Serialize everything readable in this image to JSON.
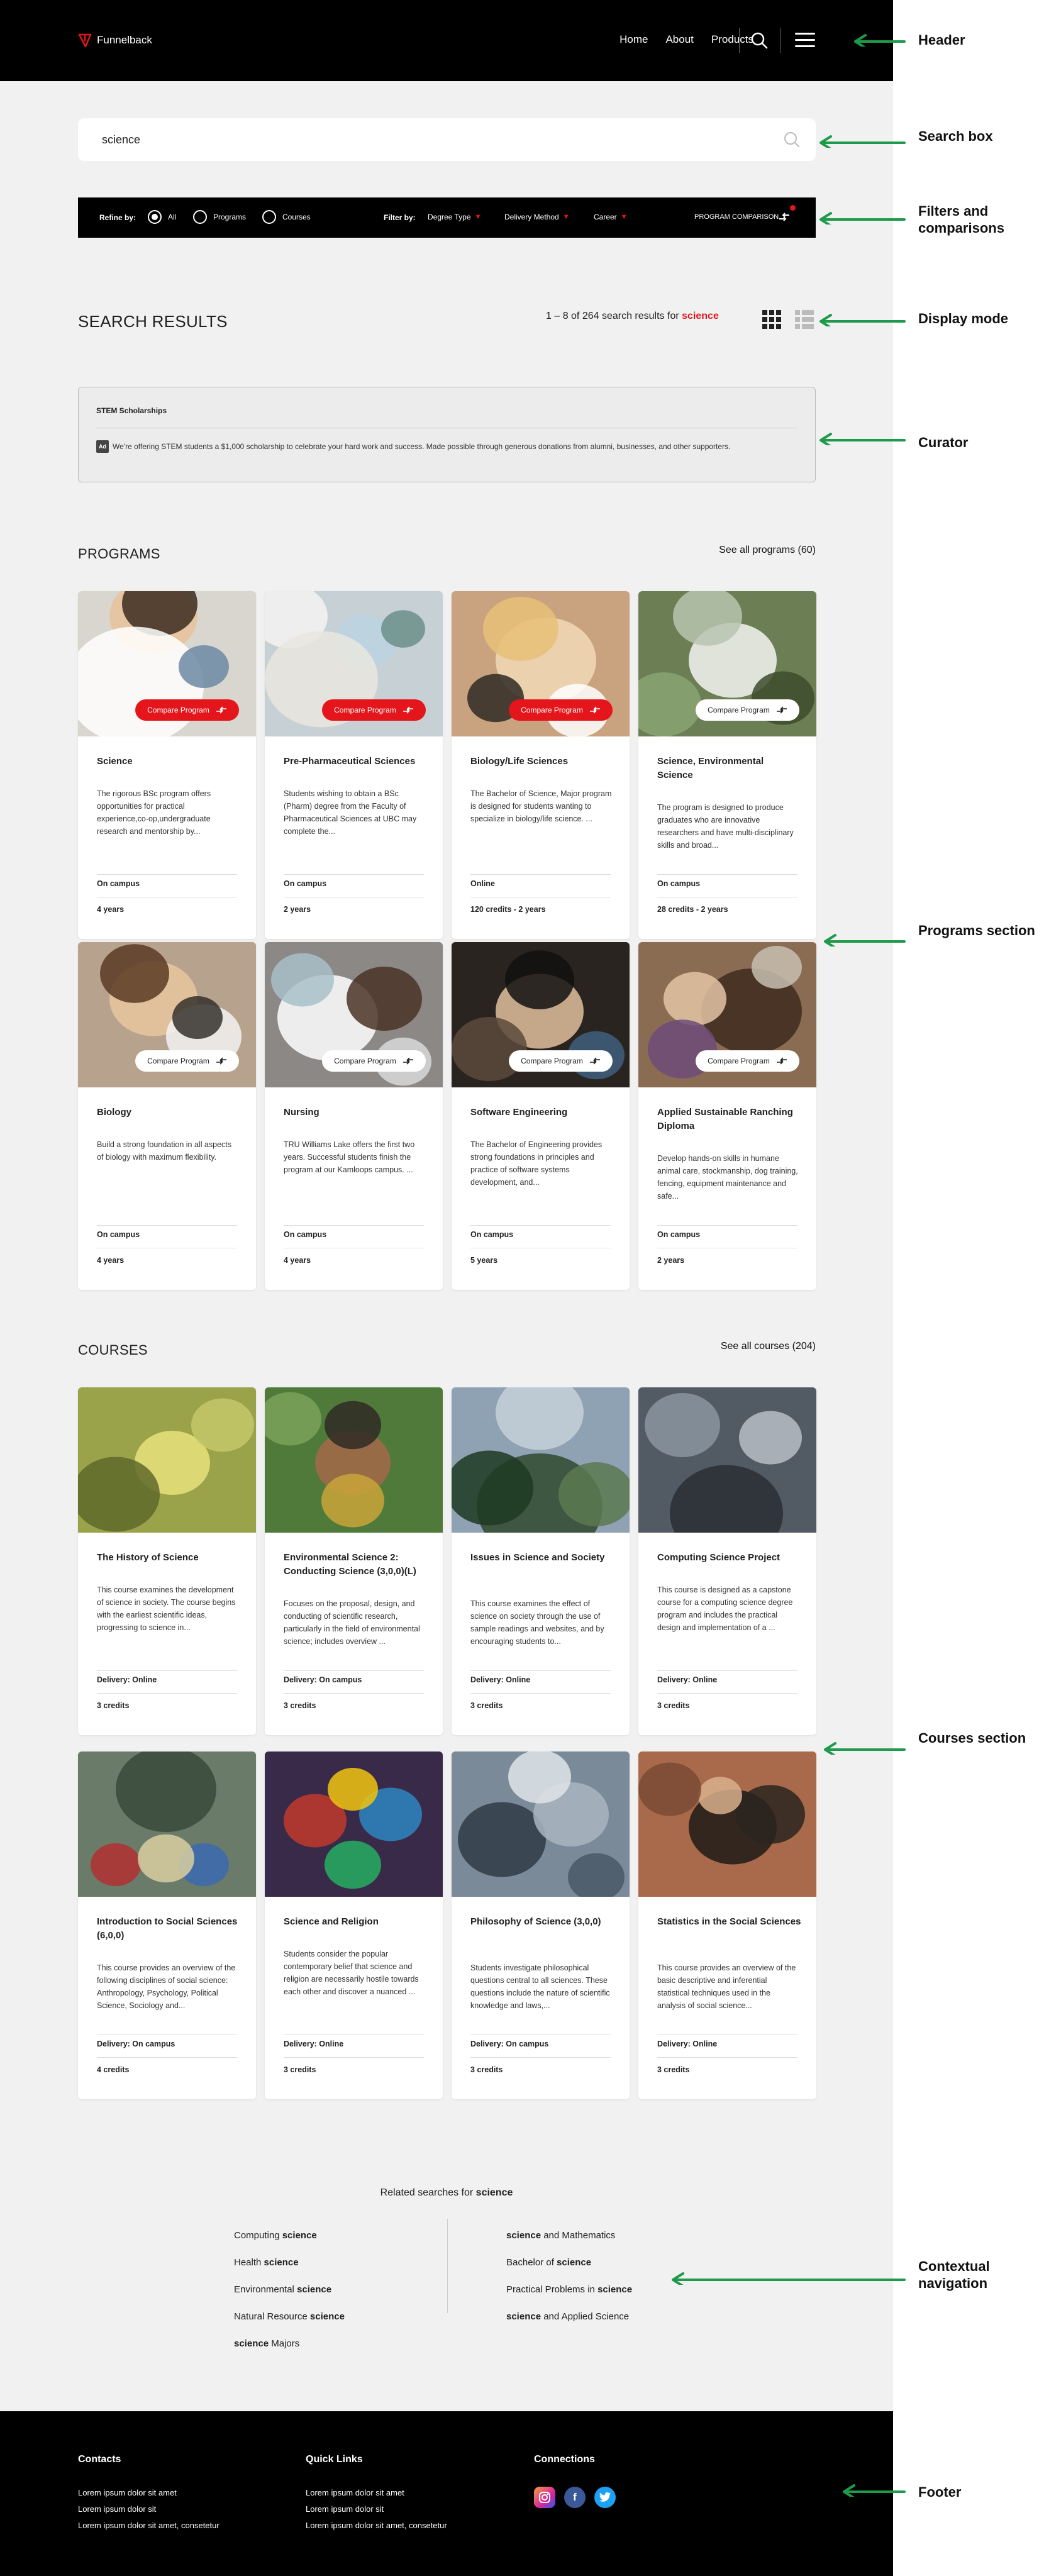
{
  "header": {
    "logo_text": "Funnelback",
    "nav": [
      "Home",
      "About",
      "Products"
    ]
  },
  "search": {
    "value": "science",
    "placeholder": ""
  },
  "filters": {
    "refine_label": "Refine by:",
    "options": [
      "All",
      "Programs",
      "Courses"
    ],
    "selected": "All",
    "filter_label": "Filter by:",
    "dropdowns": [
      "Degree Type",
      "Delivery Method",
      "Career"
    ],
    "compare_label": "PROGRAM COMPARISON"
  },
  "results": {
    "title": "SEARCH RESULTS",
    "count_prefix": "1 – 8 of 264 search results for ",
    "query": "science"
  },
  "curator": {
    "title": "STEM Scholarships",
    "badge": "Ad",
    "text": "We're offering STEM students a $1,000 scholarship to celebrate your hard work and success. Made possible through generous donations from alumni, businesses, and other supporters."
  },
  "programs": {
    "title": "PROGRAMS",
    "see_all": "See all programs (60)",
    "compare_label": "Compare Program",
    "cards": [
      {
        "title": "Science",
        "desc": "The rigorous BSc program offers opportunities for practical experience,co-op,undergraduate research and mentorship by...",
        "meta1": "On campus",
        "meta2": "4 years",
        "selected": true
      },
      {
        "title": "Pre-Pharmaceutical Sciences",
        "desc": "Students wishing to obtain a BSc (Pharm) degree from the Faculty of Pharmaceutical Sciences at UBC may complete the...",
        "meta1": "On campus",
        "meta2": "2 years",
        "selected": true
      },
      {
        "title": "Biology/Life Sciences",
        "desc": "The Bachelor of Science, Major program is designed for students wanting to specialize in biology/life science. ...",
        "meta1": "Online",
        "meta2": "120 credits - 2 years",
        "selected": true
      },
      {
        "title": "Science, Environmental Science",
        "desc": "The program is designed to produce graduates who are innovative researchers and have multi-disciplinary skills and broad...",
        "meta1": "On campus",
        "meta2": "28 credits - 2 years",
        "selected": false
      },
      {
        "title": "Biology",
        "desc": "Build a strong foundation in all aspects of biology with maximum flexibility.",
        "meta1": "On campus",
        "meta2": "4 years",
        "selected": false
      },
      {
        "title": "Nursing",
        "desc": "TRU Williams Lake offers the first two years. Successful students finish the program at our Kamloops campus. ...",
        "meta1": "On campus",
        "meta2": "4 years",
        "selected": false
      },
      {
        "title": "Software Engineering",
        "desc": "The Bachelor of Engineering provides strong foundations in principles and practice of software systems development, and...",
        "meta1": "On campus",
        "meta2": "5 years",
        "selected": false
      },
      {
        "title": "Applied Sustainable Ranching Diploma",
        "desc": "Develop hands-on skills in humane animal care, stockmanship, dog training, fencing, equipment maintenance and safe...",
        "meta1": "On campus",
        "meta2": "2 years",
        "selected": false
      }
    ]
  },
  "courses": {
    "title": "COURSES",
    "see_all": "See all courses (204)",
    "cards": [
      {
        "title": "The History of Science",
        "desc": "This course examines the development of science in society. The course begins with the earliest scientific ideas, progressing to science in...",
        "meta1": "Delivery: Online",
        "meta2": "3 credits"
      },
      {
        "title": "Environmental Science 2: Conducting Science (3,0,0)(L)",
        "desc": "Focuses on the proposal, design, and conducting of scientific research, particularly in the field of environmental science; includes overview ...",
        "meta1": "Delivery: On campus",
        "meta2": "3 credits"
      },
      {
        "title": "Issues in Science and Society",
        "desc": "This course examines the effect of science on society through the use of sample readings and websites, and by encouraging students to...",
        "meta1": "Delivery: Online",
        "meta2": "3 credits"
      },
      {
        "title": "Computing Science Project",
        "desc": "This course is designed as a capstone course for a computing science degree program and includes the practical design and implementation of a ...",
        "meta1": "Delivery: Online",
        "meta2": "3 credits"
      },
      {
        "title": "Introduction to Social Sciences (6,0,0)",
        "desc": "This course provides an overview of the following disciplines of social science: Anthropology, Psychology, Political Science, Sociology and...",
        "meta1": "Delivery: On campus",
        "meta2": "4 credits"
      },
      {
        "title": "Science and Religion",
        "desc": "Students consider the popular contemporary belief that science and religion are necessarily hostile towards each other and discover a nuanced ...",
        "meta1": "Delivery: Online",
        "meta2": "3 credits"
      },
      {
        "title": "Philosophy of Science (3,0,0)",
        "desc": "Students investigate philosophical questions central to all sciences. These questions include the nature of scientific knowledge and laws,...",
        "meta1": "Delivery: On campus",
        "meta2": "3 credits"
      },
      {
        "title": "Statistics in the Social Sciences",
        "desc": "This course provides an overview of the basic descriptive and inferential statistical techniques used in the analysis of social science...",
        "meta1": "Delivery: Online",
        "meta2": "3 credits"
      }
    ]
  },
  "related": {
    "title_prefix": "Related searches for ",
    "query": "science",
    "left": [
      "Computing science",
      "Health science",
      "Environmental science",
      "Natural Resource science",
      "science Majors"
    ],
    "right": [
      "science and Mathematics",
      "Bachelor of science",
      "Practical Problems in science",
      "science and Applied Science"
    ]
  },
  "footer": {
    "columns": [
      {
        "title": "Contacts",
        "links": [
          "Lorem ipsum dolor sit amet",
          "Lorem ipsum dolor sit",
          "Lorem ipsum dolor sit amet, consetetur"
        ]
      },
      {
        "title": "Quick Links",
        "links": [
          "Lorem ipsum dolor sit amet",
          "Lorem ipsum dolor sit",
          "Lorem ipsum dolor sit amet, consetetur"
        ]
      },
      {
        "title": "Connections",
        "links": []
      }
    ],
    "social": [
      "instagram-icon",
      "facebook-icon",
      "twitter-icon"
    ]
  },
  "annotations": [
    "Header",
    "Search box",
    "Filters and comparisons",
    "Display mode",
    "Curator",
    "Programs section",
    "Courses section",
    "Contextual navigation",
    "Footer"
  ],
  "colors": {
    "accent": "#e4161b",
    "arrow": "#1f9a4b",
    "header_bg": "#000000",
    "page_bg": "#f1f1f1"
  }
}
